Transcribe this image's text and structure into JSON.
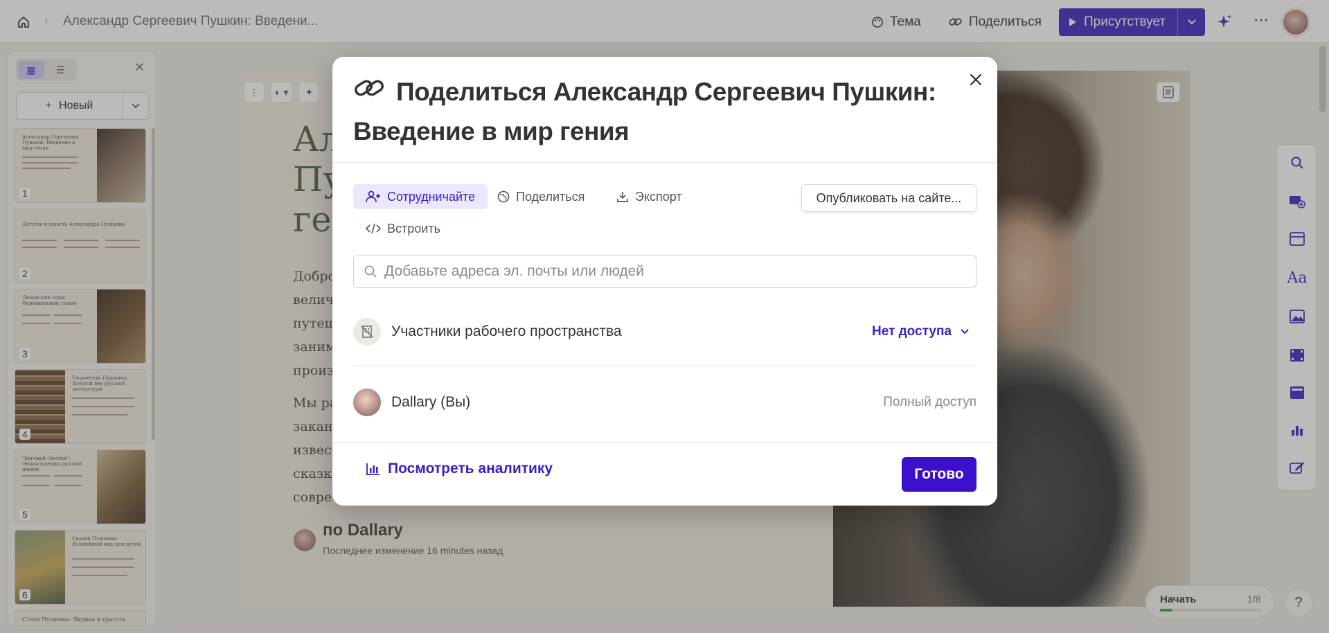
{
  "topbar": {
    "breadcrumb_title": "Александр Сергеевич Пушкин: Введени...",
    "theme_label": "Тема",
    "share_label": "Поделиться",
    "present_label": "Присутствует"
  },
  "left_panel": {
    "new_label": "Новый",
    "slides": [
      {
        "number": "1",
        "title": "Александр Сергеевич Пушкин: Введение в мир гения"
      },
      {
        "number": "2",
        "title": "Детство и юность Александра Пушкина"
      },
      {
        "number": "3",
        "title": "Лицейские годы: Формирование гения"
      },
      {
        "number": "4",
        "title": "Творчество Пушкина: Золотой век русской литературы"
      },
      {
        "number": "5",
        "title": "\"Евгений Онегин\": Энциклопедия русской жизни"
      },
      {
        "number": "6",
        "title": "Сказки Пушкина: Волшебный мир для детей"
      },
      {
        "number": "",
        "title": "Стихи Пушкина: Лирика и красота"
      }
    ]
  },
  "slide": {
    "title_fragments": [
      "Ал",
      "Пу",
      "ген"
    ],
    "body_lines_1": [
      "Добро",
      "велича",
      "путеш",
      "заним",
      "произ"
    ],
    "body_lines_2": [
      "Мы ра",
      "заканч",
      "извест",
      "сказк",
      "совре"
    ],
    "author": "по Dallary",
    "edited": "Последнее изменение 16 minutes назад"
  },
  "start_widget": {
    "label": "Начать",
    "count": "1/8",
    "progress": 0.125
  },
  "help_label": "?",
  "modal": {
    "title": "Поделиться Александр Сергеевич Пушкин: Введение в мир гения",
    "tabs": {
      "collaborate": "Сотрудничайте",
      "share": "Поделиться",
      "export": "Экспорт",
      "embed": "Встроить"
    },
    "publish_label": "Опубликовать на сайте...",
    "search_placeholder": "Добавьте адреса эл. почты или людей",
    "workspace_members": {
      "label": "Участники рабочего пространства",
      "access": "Нет доступа"
    },
    "owner": {
      "label": "Dallary (Вы)",
      "access": "Полный доступ"
    },
    "analytics_label": "Посмотреть аналитику",
    "done_label": "Готово"
  },
  "colors": {
    "accent": "#3b1fc1",
    "done_button": "#3b10cc"
  }
}
